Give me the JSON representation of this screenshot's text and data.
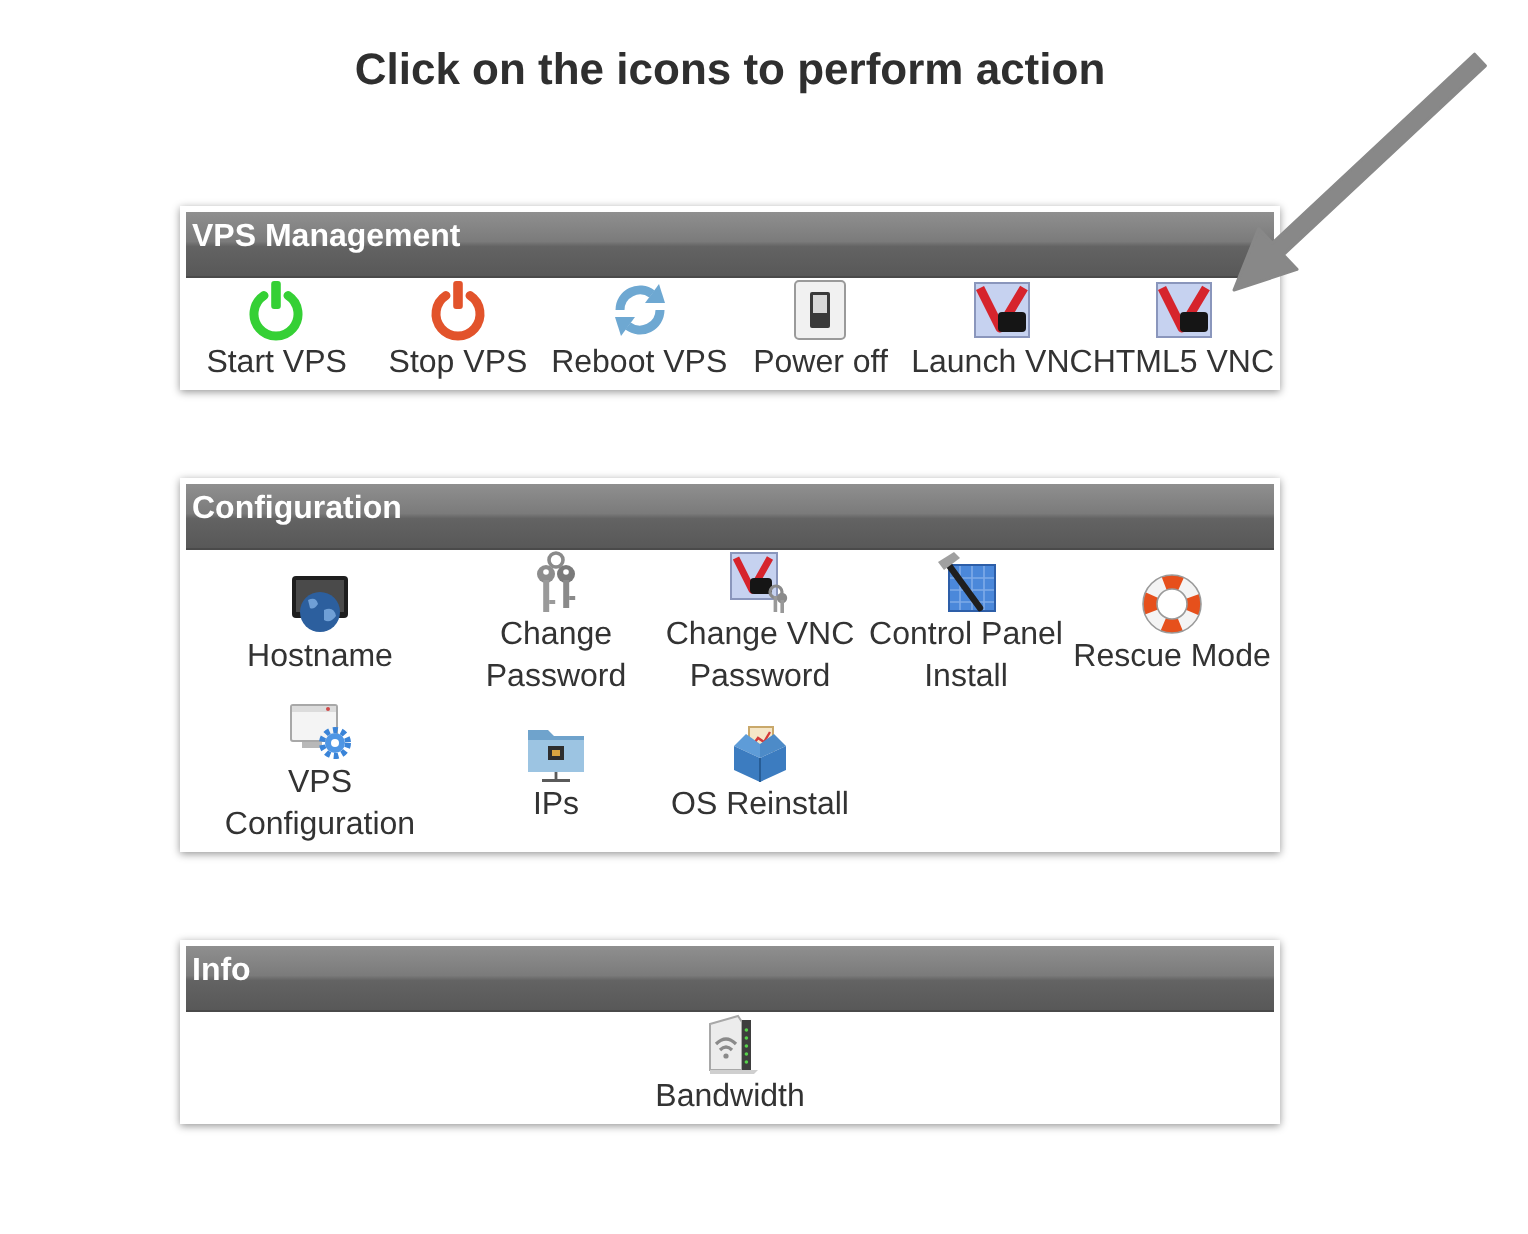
{
  "heading": "Click on the icons to perform action",
  "panels": [
    {
      "title": "VPS Management",
      "kind": "strip",
      "items": [
        {
          "label": "Start VPS",
          "kind": "start"
        },
        {
          "label": "Stop VPS",
          "kind": "stop"
        },
        {
          "label": "Reboot VPS",
          "kind": "reboot"
        },
        {
          "label": "Power off",
          "kind": "poweroff"
        },
        {
          "label": "Launch VNC",
          "kind": "vnc"
        },
        {
          "label": "HTML5 VNC",
          "kind": "vnc"
        }
      ]
    },
    {
      "title": "Configuration",
      "kind": "grid",
      "items": [
        {
          "label": "Hostname",
          "kind": "hostname"
        },
        {
          "label": "Change Password",
          "kind": "password"
        },
        {
          "label": "Change VNC Password",
          "kind": "vncpassword"
        },
        {
          "label": "Control Panel Install",
          "kind": "controlpanel"
        },
        {
          "label": "Rescue Mode",
          "kind": "rescue"
        },
        {
          "label": "VPS Configuration",
          "kind": "vpsconfig"
        },
        {
          "label": "IPs",
          "kind": "ips"
        },
        {
          "label": "OS Reinstall",
          "kind": "reinstall"
        }
      ]
    },
    {
      "title": "Info",
      "kind": "single",
      "items": [
        {
          "label": "Bandwidth",
          "kind": "bandwidth"
        }
      ]
    }
  ]
}
